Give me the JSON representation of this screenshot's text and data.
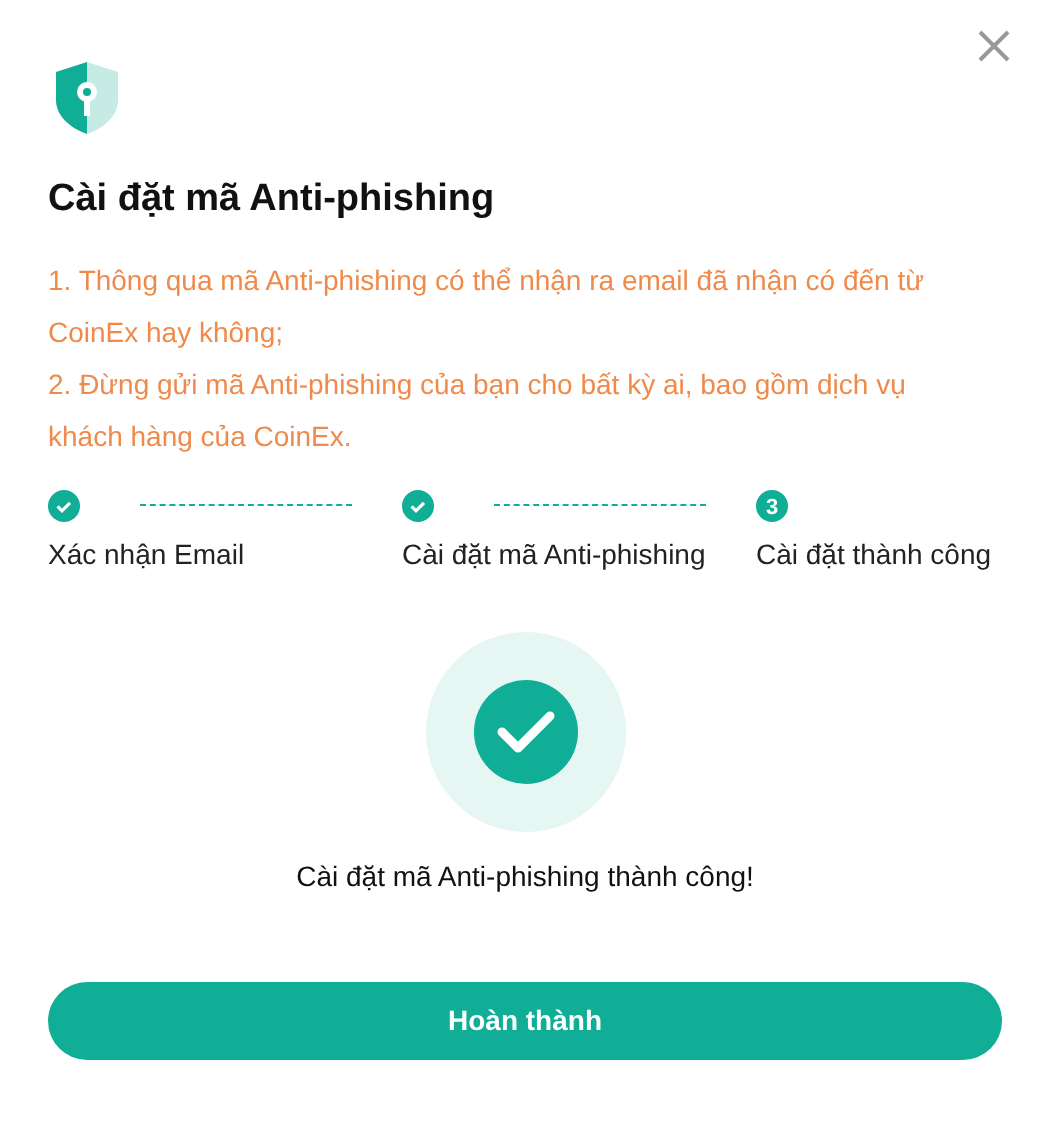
{
  "title": "Cài đặt mã Anti-phishing",
  "notes": [
    "1. Thông qua mã Anti-phishing có thể nhận ra email đã nhận có đến từ CoinEx hay không;",
    "2. Đừng gửi mã Anti-phishing của bạn cho bất kỳ ai, bao gồm dịch vụ khách hàng của CoinEx."
  ],
  "steps": [
    {
      "label": "Xác nhận Email",
      "completed": true
    },
    {
      "label": "Cài đặt mã Anti-phishing",
      "completed": true
    },
    {
      "label": "Cài đặt thành công",
      "completed": false,
      "number": "3"
    }
  ],
  "message": "Cài đặt mã Anti-phishing thành công!",
  "button": "Hoàn thành"
}
